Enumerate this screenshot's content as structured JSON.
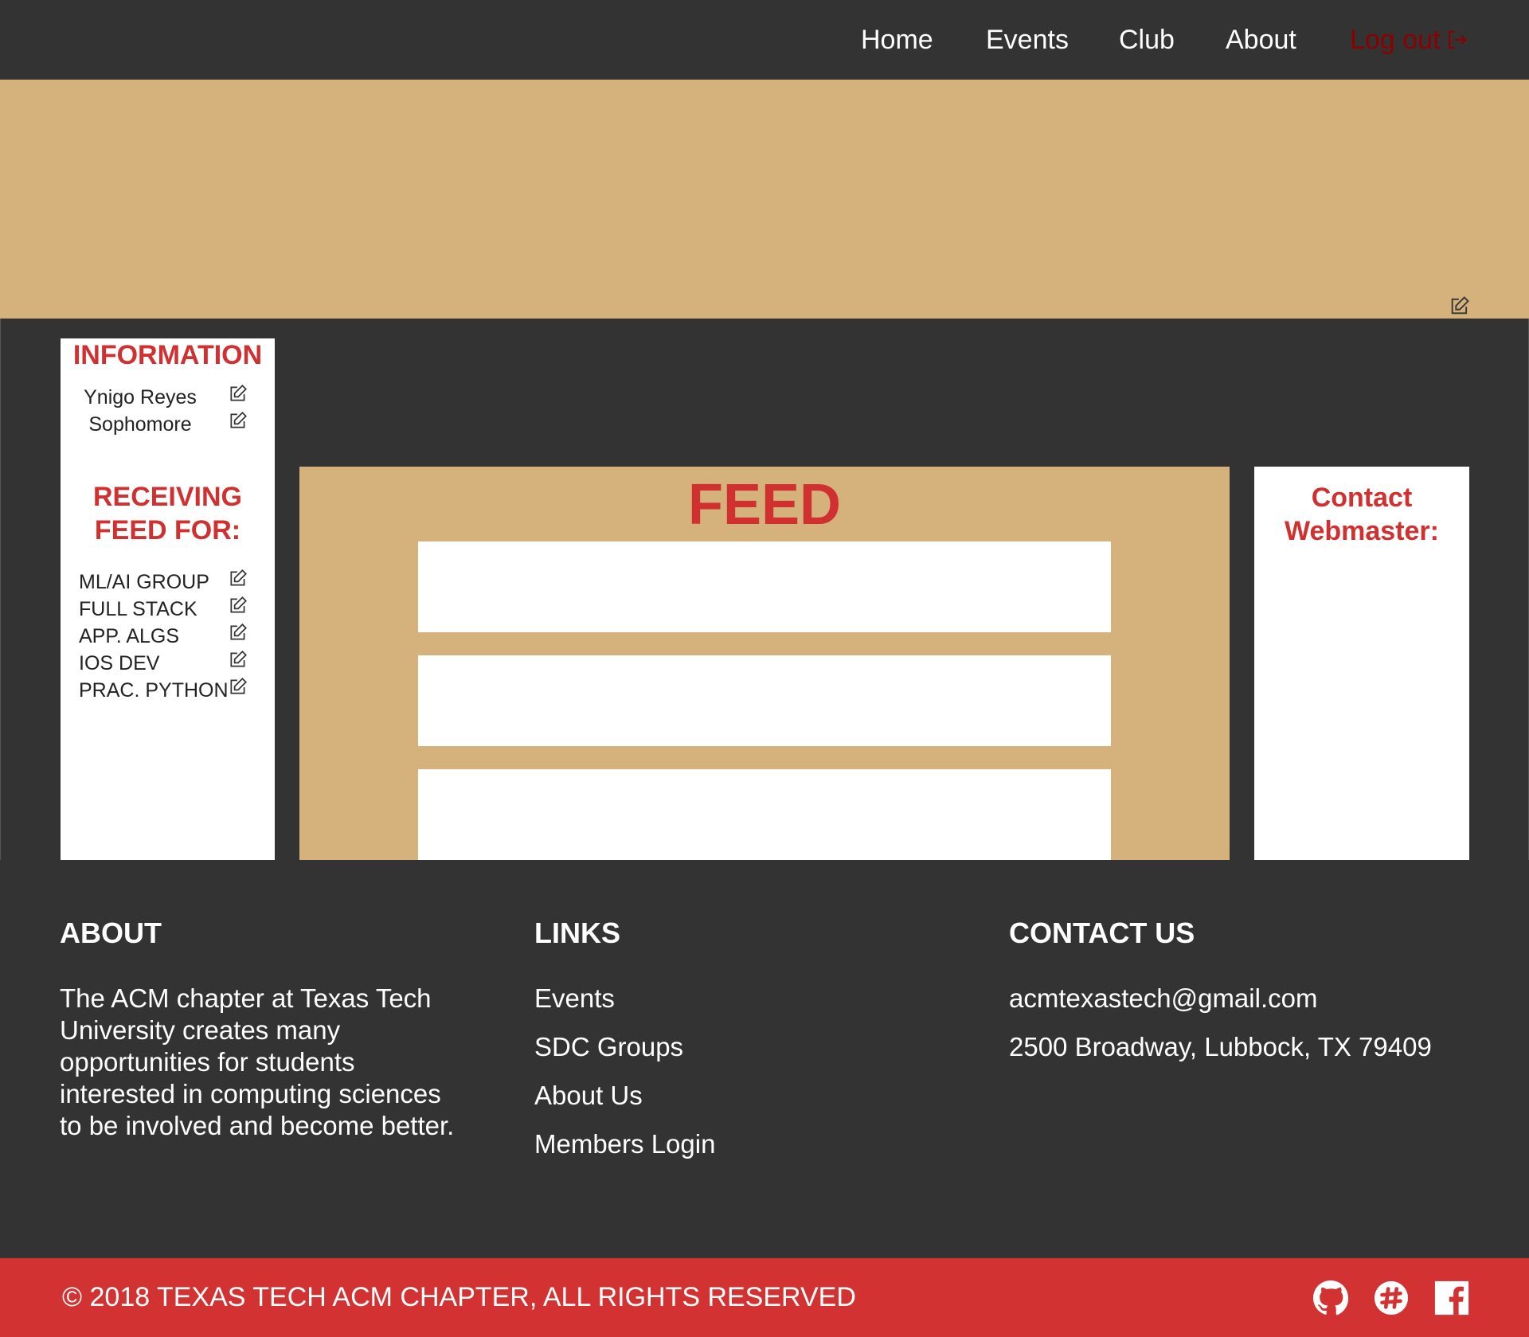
{
  "nav": {
    "items": [
      {
        "label": "Home"
      },
      {
        "label": "Events"
      },
      {
        "label": "Club"
      },
      {
        "label": "About"
      }
    ],
    "logout_label": "Log out",
    "logout_icon": "logout-icon"
  },
  "profile": {
    "banner_edit_icon": "edit-icon",
    "avatar_color": "#8b0000"
  },
  "info": {
    "heading": "INFORMATION",
    "name": "Ynigo Reyes",
    "year": "Sophomore",
    "receiving_heading_line1": "RECEIVING",
    "receiving_heading_line2": "FEED FOR:",
    "groups": [
      "ML/AI GROUP",
      "FULL STACK",
      "APP. ALGS",
      "IOS DEV",
      "PRAC. PYTHON"
    ]
  },
  "feed": {
    "title": "FEED",
    "cards": 3
  },
  "contact": {
    "heading_line1": "Contact",
    "heading_line2": "Webmaster:"
  },
  "footer": {
    "about_heading": "ABOUT",
    "about_lines": [
      "The ACM chapter at Texas Tech",
      "University creates many",
      "opportunities for students",
      "interested in computing sciences",
      "to be involved and become better."
    ],
    "links_heading": "LINKS",
    "links": [
      "Events",
      "SDC Groups",
      "About Us",
      "Members Login"
    ],
    "contact_heading": "CONTACT US",
    "email": "acmtexastech@gmail.com",
    "address": "2500 Broadway, Lubbock, TX 79409",
    "copyright": "© 2018 TEXAS TECH ACM CHAPTER, ALL RIGHTS RESERVED",
    "social_icons": [
      "github-icon",
      "slack-icon",
      "facebook-icon"
    ]
  },
  "colors": {
    "dark": "#333333",
    "tan": "#d5b27c",
    "red": "#d03030",
    "dark_red": "#8b0000"
  }
}
